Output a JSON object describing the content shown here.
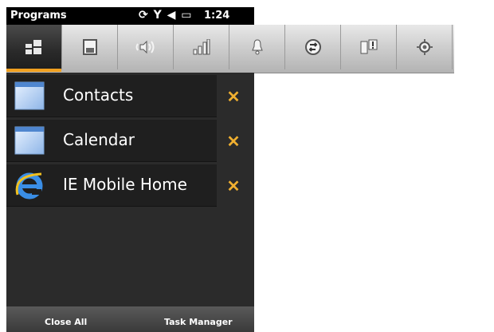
{
  "statusbar": {
    "title": "Programs",
    "icons": [
      "sync-icon",
      "signal-icon",
      "speaker-icon",
      "battery-icon"
    ],
    "time": "1:24"
  },
  "tabs": [
    {
      "name": "programs-tab",
      "icon": "programs-icon",
      "active": true
    },
    {
      "name": "memory-tab",
      "icon": "memory-icon",
      "active": false
    },
    {
      "name": "sound-tab",
      "icon": "sound-icon",
      "active": false
    },
    {
      "name": "signal-tab",
      "icon": "signal-icon",
      "active": false
    },
    {
      "name": "notification-tab",
      "icon": "bell-icon",
      "active": false
    },
    {
      "name": "connection-tab",
      "icon": "connection-icon",
      "active": false
    },
    {
      "name": "device-tab",
      "icon": "device-icon",
      "active": false
    },
    {
      "name": "settings-tab",
      "icon": "gear-icon",
      "active": false
    }
  ],
  "programs": [
    {
      "label": "Contacts",
      "icon": "window-icon",
      "close": "✕"
    },
    {
      "label": "Calendar",
      "icon": "window-icon",
      "close": "✕"
    },
    {
      "label": "IE Mobile Home",
      "icon": "internet-explorer-icon",
      "close": "✕"
    }
  ],
  "bottom": {
    "close_all": "Close All",
    "task_manager": "Task Manager"
  },
  "colors": {
    "accent": "#f0a020",
    "close_x": "#f0b030",
    "panel_bg": "#2b2b2b"
  }
}
